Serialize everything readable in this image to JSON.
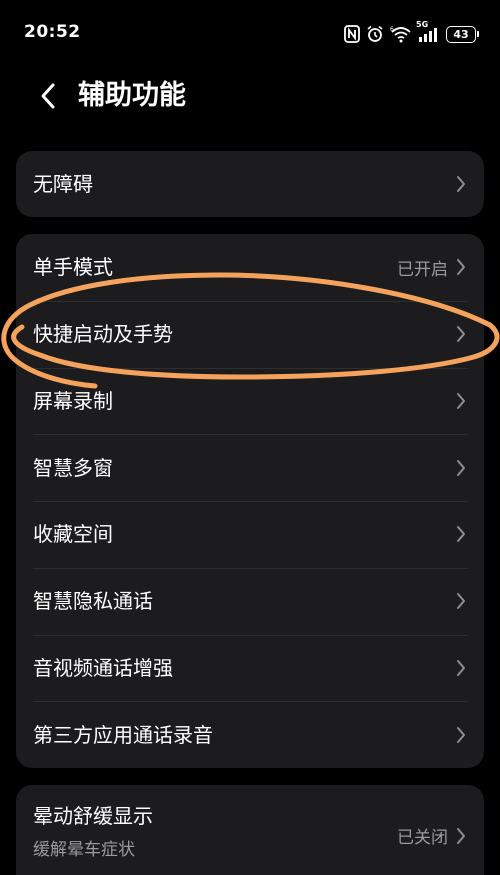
{
  "status_bar": {
    "time": "20:52",
    "battery_level": "43",
    "network_label": "5G",
    "icons": [
      "nfc-icon",
      "alarm-icon",
      "wifi-icon",
      "signal-icon",
      "battery-icon"
    ]
  },
  "header": {
    "title": "辅助功能",
    "back_icon": "chevron-left-icon"
  },
  "group1": {
    "items": [
      {
        "label": "无障碍"
      }
    ]
  },
  "group2": {
    "items": [
      {
        "label": "单手模式",
        "value": "已开启"
      },
      {
        "label": "快捷启动及手势"
      },
      {
        "label": "屏幕录制"
      },
      {
        "label": "智慧多窗"
      },
      {
        "label": "收藏空间"
      },
      {
        "label": "智慧隐私通话"
      },
      {
        "label": "音视频通话增强"
      },
      {
        "label": "第三方应用通话录音"
      }
    ]
  },
  "group3": {
    "items": [
      {
        "label": "晕动舒缓显示",
        "subtitle": "缓解晕车症状",
        "value": "已关闭"
      }
    ]
  },
  "colors": {
    "background": "#000000",
    "card": "#1c1c1e",
    "secondary_text": "#9a9a9f",
    "annotation_stroke": "#f5a35c"
  }
}
